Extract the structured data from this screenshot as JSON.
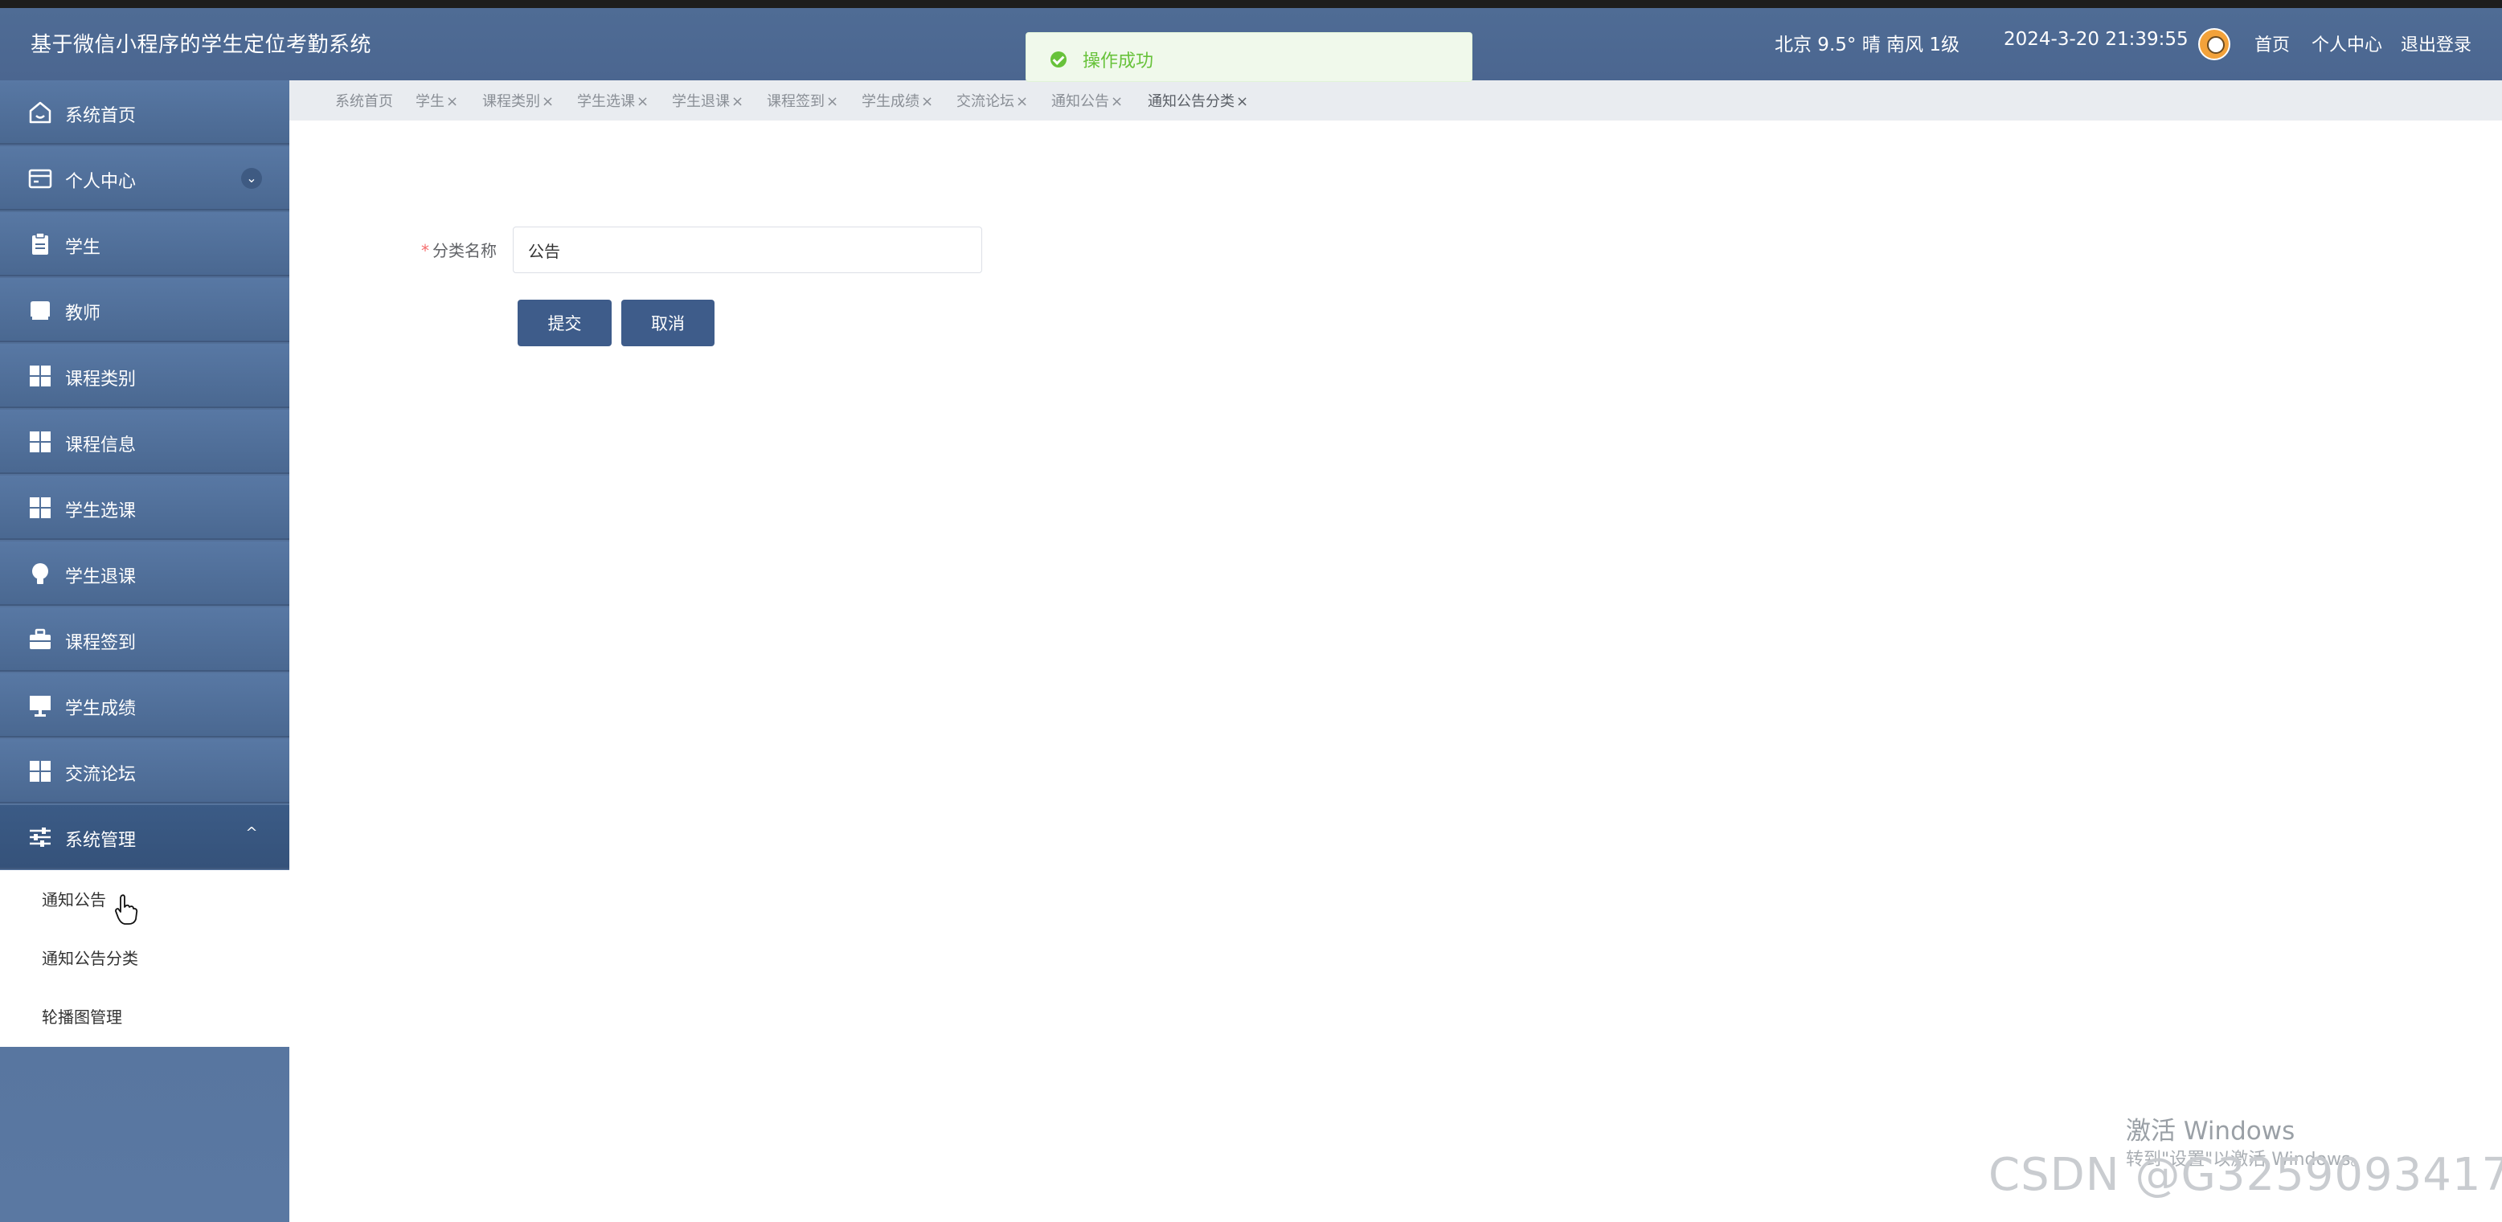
{
  "header": {
    "title": "基于微信小程序的学生定位考勤系统",
    "weather": "北京  9.5°  晴  南风  1级",
    "datetime": "2024-3-20 21:39:55",
    "links": [
      "首页",
      "个人中心",
      "退出登录"
    ]
  },
  "toast": {
    "message": "操作成功",
    "type": "success"
  },
  "sidebar": {
    "items": [
      {
        "label": "系统首页",
        "icon": "home-icon"
      },
      {
        "label": "个人中心",
        "icon": "wallet-icon",
        "expandable": true,
        "expanded": false
      },
      {
        "label": "学生",
        "icon": "clipboard-icon"
      },
      {
        "label": "教师",
        "icon": "inbox-icon"
      },
      {
        "label": "课程类别",
        "icon": "grid-icon"
      },
      {
        "label": "课程信息",
        "icon": "grid-icon"
      },
      {
        "label": "学生选课",
        "icon": "grid-icon"
      },
      {
        "label": "学生退课",
        "icon": "lightbulb-icon"
      },
      {
        "label": "课程签到",
        "icon": "briefcase-icon"
      },
      {
        "label": "学生成绩",
        "icon": "monitor-icon"
      },
      {
        "label": "交流论坛",
        "icon": "grid-icon"
      },
      {
        "label": "系统管理",
        "icon": "sliders-icon",
        "expandable": true,
        "expanded": true
      }
    ],
    "submenu": [
      "通知公告",
      "通知公告分类",
      "轮播图管理"
    ]
  },
  "tabs": [
    {
      "label": "系统首页",
      "closable": false
    },
    {
      "label": "学生",
      "closable": true
    },
    {
      "label": "课程类别",
      "closable": true
    },
    {
      "label": "学生选课",
      "closable": true
    },
    {
      "label": "学生退课",
      "closable": true
    },
    {
      "label": "课程签到",
      "closable": true
    },
    {
      "label": "学生成绩",
      "closable": true
    },
    {
      "label": "交流论坛",
      "closable": true
    },
    {
      "label": "通知公告",
      "closable": true
    },
    {
      "label": "通知公告分类",
      "closable": true,
      "active": true
    }
  ],
  "tab_close_glyph": "×",
  "form": {
    "required_mark": "*",
    "field_label": "分类名称",
    "field_value": "公告",
    "submit_label": "提交",
    "cancel_label": "取消"
  },
  "watermark": {
    "line1": "激活 Windows",
    "line2": "转到\"设置\"以激活 Windows。",
    "csdn": "CSDN @G3259093417"
  },
  "colors": {
    "header_bg": "#4f6c95",
    "button_bg": "#3e5c8a",
    "success": "#67c23a",
    "required": "#f56c6c"
  }
}
